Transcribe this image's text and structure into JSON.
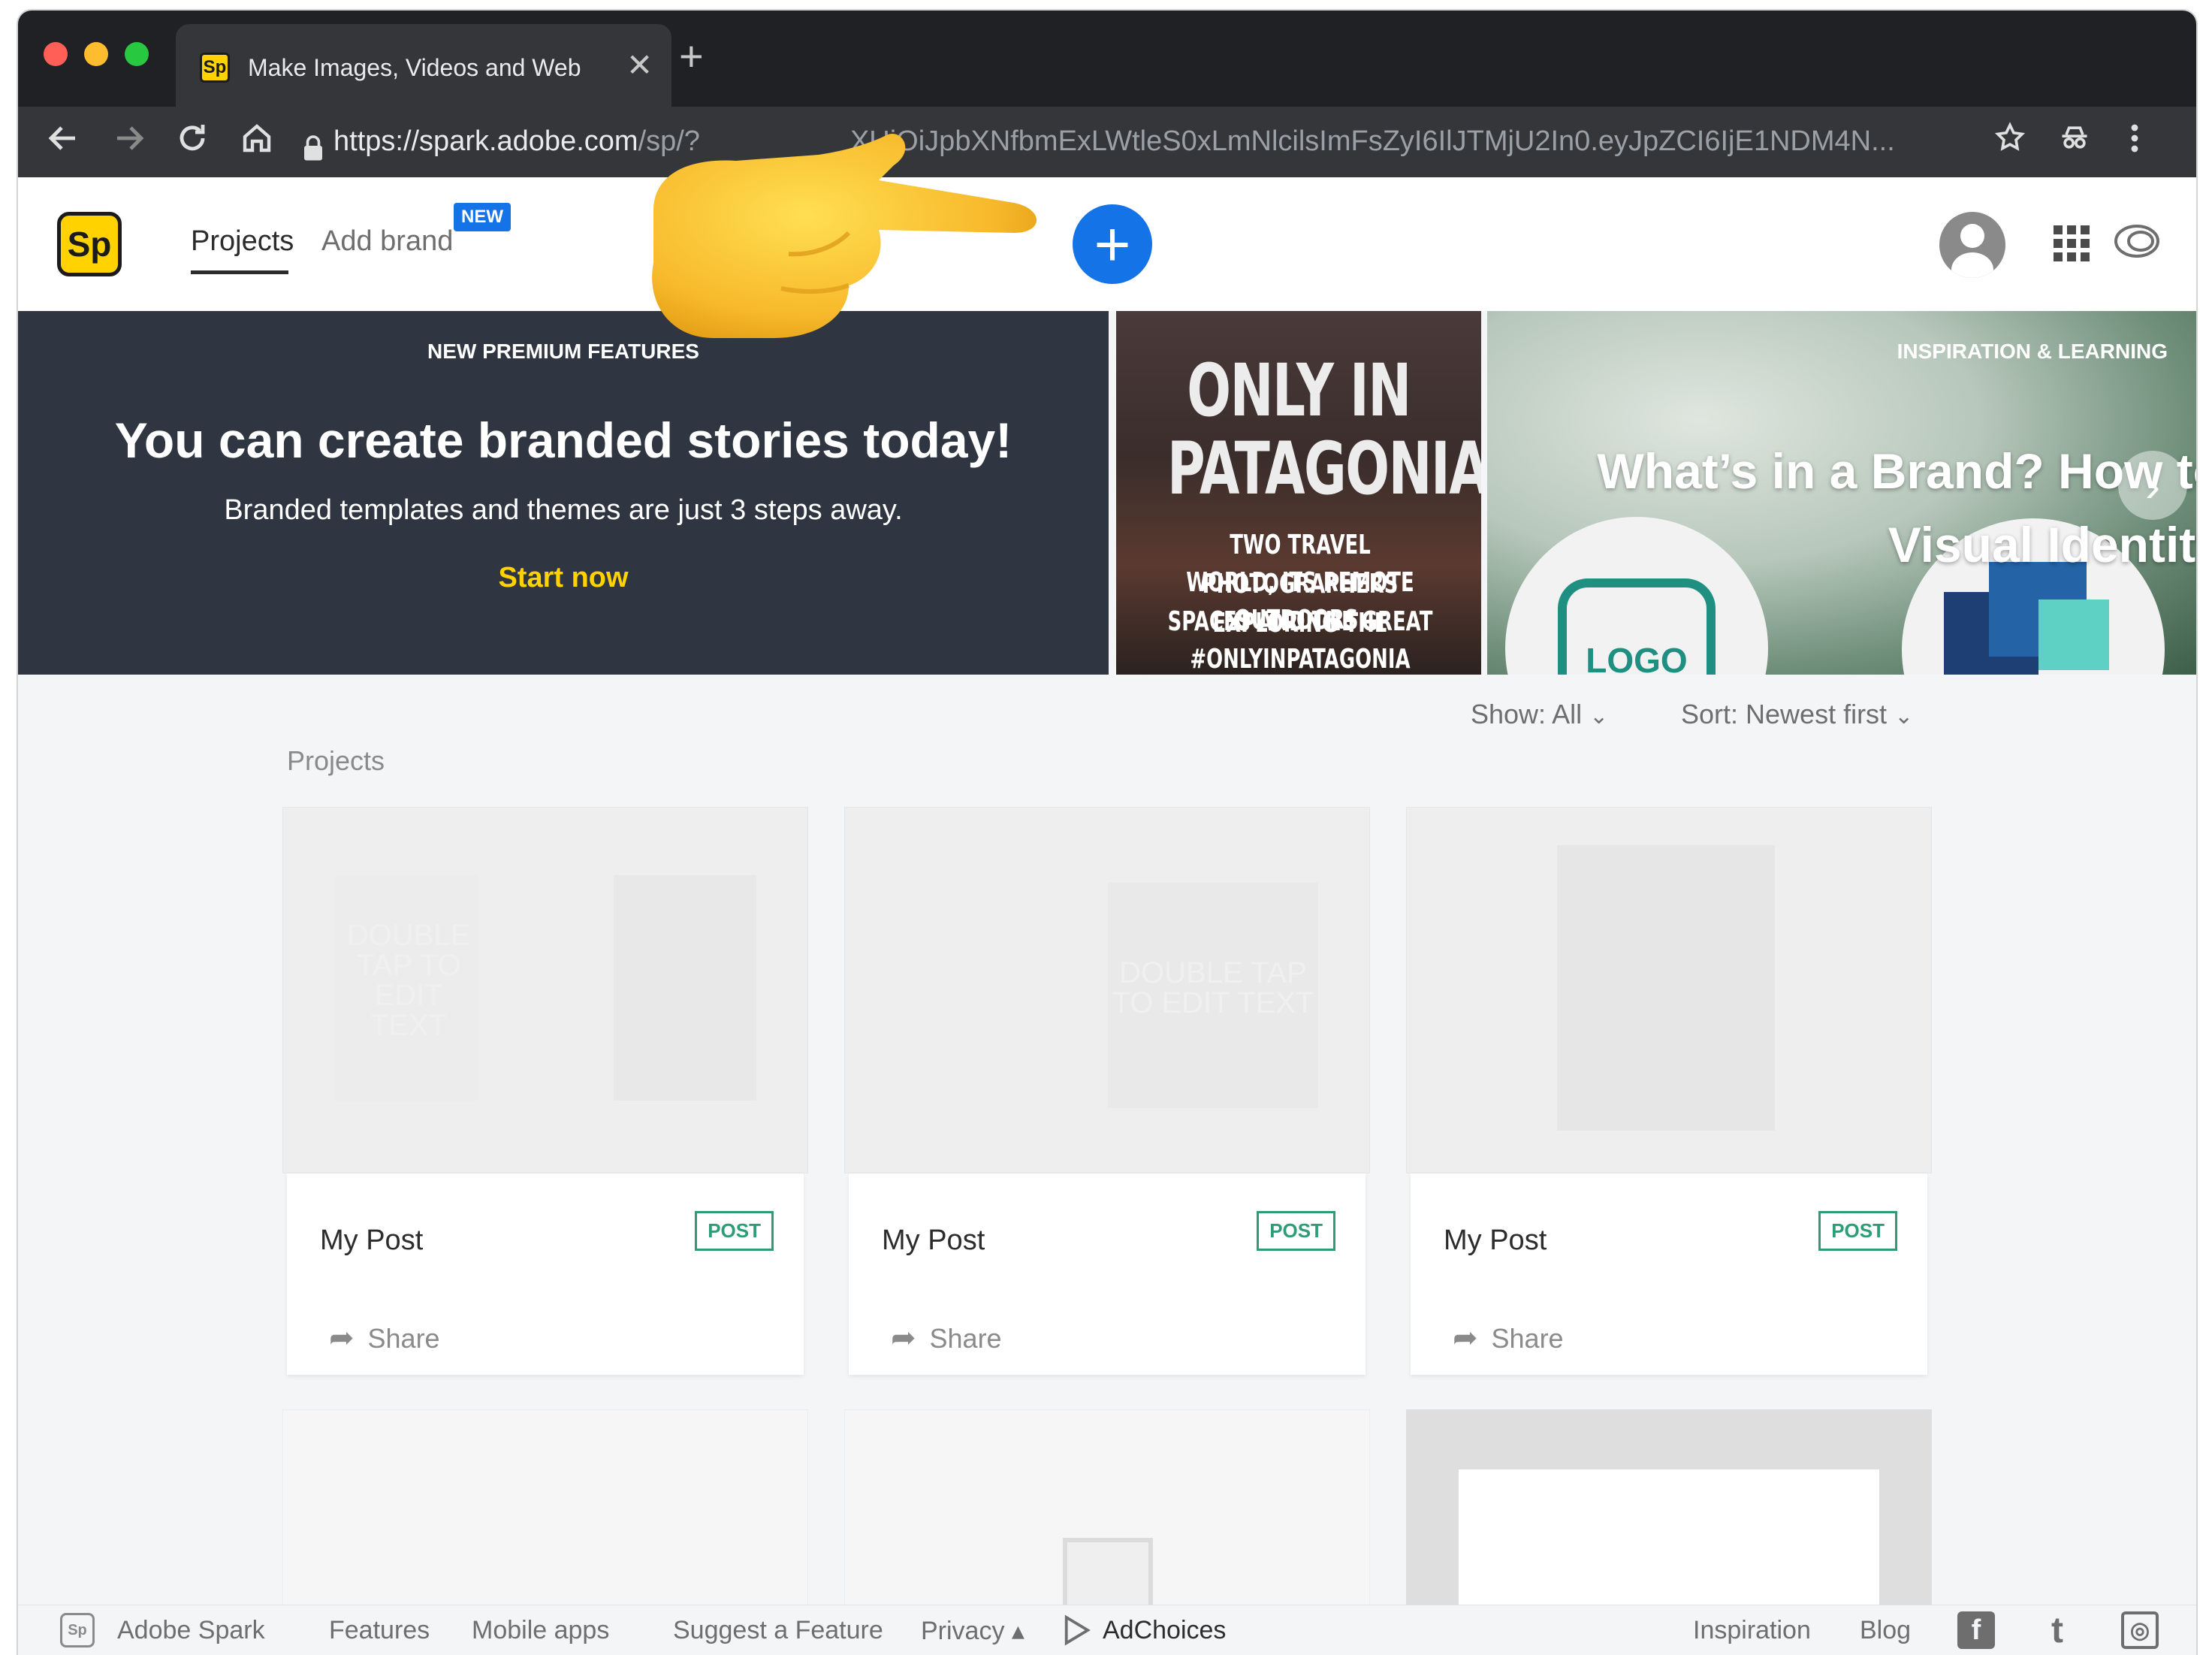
{
  "browser": {
    "tab_title": "Make Images, Videos and Web",
    "tab_favicon": "Sp",
    "close_glyph": "✕",
    "newtab_glyph": "+",
    "url_host": "https://spark.adobe.com",
    "url_path_dim": "/sp/?",
    "url_rest": "XUiOiJpbXNfbmExLWtleS0xLmNlcilsImFsZyI6IlJTMjU2In0.eyJpZCI6IjE1NDM4N...",
    "nav_icons": [
      "back-icon",
      "forward-icon",
      "reload-icon",
      "home-icon",
      "lock-icon",
      "star-icon",
      "incognito-icon",
      "more-icon"
    ],
    "traffic_colors": [
      "#ff5f57",
      "#febc2e",
      "#28c840"
    ]
  },
  "app": {
    "logo": "Sp",
    "nav": {
      "projects": "Projects",
      "add_brand": "Add brand",
      "new_badge": "NEW"
    },
    "create_button": "+",
    "accent": "#1473e6",
    "brand_yellow": "#ffd200"
  },
  "banner": {
    "kicker": "NEW PREMIUM FEATURES",
    "title": "You can create branded stories today!",
    "subtitle": "Branded templates and themes are just 3 steps away.",
    "cta": "Start now",
    "patagonia": {
      "line1": "ONLY IN",
      "line2": "PATAGONIA",
      "line3": "TWO TRAVEL PHOTOGRAPHERS EXPLORING THE",
      "line4": "WORLD, ITS REMOTE SPACES AND THE GREAT",
      "line5": "OUTDOORS. #ONLYINPATAGONIA"
    },
    "inspiration": {
      "kicker": "INSPIRATION & LEARNING",
      "title": "What’s in a Brand? How to Visual Identity",
      "logo_text": "LOGO",
      "next_glyph": "›"
    }
  },
  "filters": {
    "show": "Show: All",
    "sort": "Sort: Newest first",
    "chevron": "⌄"
  },
  "projects": {
    "label": "Projects",
    "cards": [
      {
        "name": "My Post",
        "type": "POST",
        "share": "Share",
        "ghost": "DOUBLE TAP TO EDIT TEXT"
      },
      {
        "name": "My Post",
        "type": "POST",
        "share": "Share",
        "ghost": "DOUBLE TAP TO EDIT TEXT"
      },
      {
        "name": "My Post",
        "type": "POST",
        "share": "Share",
        "ghost": ""
      }
    ],
    "post_badge_color": "#2d9d78"
  },
  "footer": {
    "logo": "Sp",
    "brand": "Adobe Spark",
    "features": "Features",
    "mobile_apps": "Mobile apps",
    "suggest": "Suggest a Feature",
    "privacy": "Privacy ▴",
    "adchoices": "AdChoices",
    "inspiration": "Inspiration",
    "blog": "Blog",
    "social": {
      "facebook": "f",
      "twitter": "t",
      "instagram": "◎"
    }
  }
}
